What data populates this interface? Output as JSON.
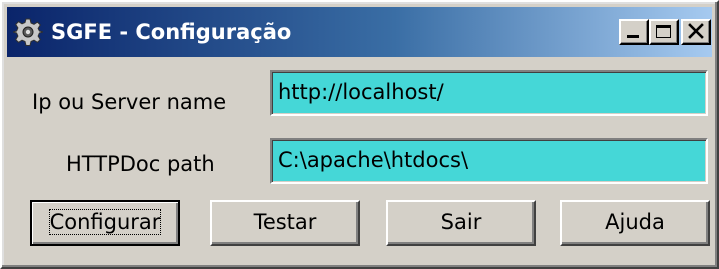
{
  "window": {
    "title": "SGFE - Configuração",
    "icon": "gear-icon",
    "controls": [
      "minimize-icon",
      "maximize-icon",
      "close-icon"
    ]
  },
  "form": {
    "ip_label": "Ip ou Server name",
    "ip_value": "http://localhost/",
    "doc_label": "HTTPDoc path",
    "doc_value": "C:\\apache\\htdocs\\"
  },
  "buttons": {
    "configurar": "Configurar",
    "testar": "Testar",
    "sair": "Sair",
    "ajuda": "Ajuda"
  },
  "colors": {
    "titlebar_start": "#0a246a",
    "titlebar_end": "#a6caf0",
    "field_background": "#45d7d7",
    "face": "#d4d0c8"
  }
}
